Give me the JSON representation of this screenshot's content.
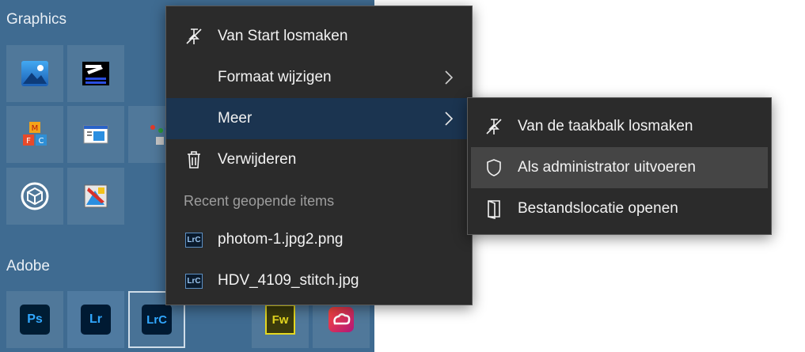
{
  "start_menu": {
    "groups": [
      {
        "title": "Graphics"
      },
      {
        "title": "Adobe"
      }
    ],
    "adobe_tiles": [
      {
        "label": "Ps"
      },
      {
        "label": "Lr"
      },
      {
        "label": "LrC"
      },
      {
        "label": "Fw"
      }
    ]
  },
  "context_menu": {
    "items": [
      {
        "label": "Van Start losmaken",
        "icon": "unpin-icon"
      },
      {
        "label": "Formaat wijzigen",
        "icon": ""
      },
      {
        "label": "Meer",
        "icon": ""
      },
      {
        "label": "Verwijderen",
        "icon": "trash-icon"
      }
    ],
    "recent_header": "Recent geopende items",
    "recent_items": [
      {
        "label": "photom-1.jpg2.png",
        "icon": "LrC"
      },
      {
        "label": "HDV_4109_stitch.jpg",
        "icon": "LrC"
      }
    ]
  },
  "submenu": {
    "items": [
      {
        "label": "Van de taakbalk losmaken",
        "icon": "unpin-icon"
      },
      {
        "label": "Als administrator uitvoeren",
        "icon": "shield-icon"
      },
      {
        "label": "Bestandslocatie openen",
        "icon": "folder-open-icon"
      }
    ]
  },
  "colors": {
    "start_background": "#3f6b91",
    "menu_background": "#2b2b2b",
    "active_item": "#1b3450",
    "hover_item": "#454545"
  }
}
